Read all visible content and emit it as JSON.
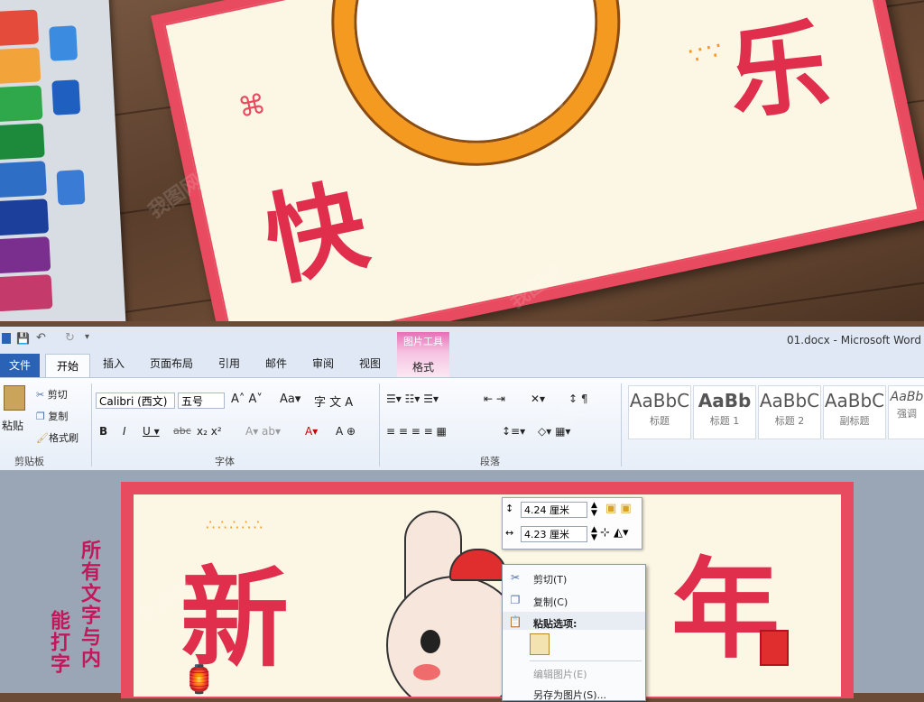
{
  "photo": {
    "chars": [
      "快",
      "乐"
    ]
  },
  "qat": {
    "title": "01.docx  -  Microsoft Word"
  },
  "tabs": {
    "file": "文件",
    "home": "开始",
    "items": [
      "插入",
      "页面布局",
      "引用",
      "邮件",
      "审阅",
      "视图"
    ],
    "picture_tools": "图片工具",
    "format": "格式"
  },
  "clipboard": {
    "paste": "粘贴",
    "cut": "剪切",
    "copy": "复制",
    "format_painter": "格式刷",
    "group": "剪贴板"
  },
  "font": {
    "name": "Calibri (西文)",
    "size": "五号",
    "group": "字体"
  },
  "paragraph": {
    "group": "段落"
  },
  "styles": {
    "items": [
      {
        "sample": "AaBbC",
        "name": "标题"
      },
      {
        "sample": "AaBb",
        "name": "标题 1"
      },
      {
        "sample": "AaBbC",
        "name": "标题 2"
      },
      {
        "sample": "AaBbC",
        "name": "副标题"
      },
      {
        "sample": "AaBb",
        "name": "强调"
      }
    ]
  },
  "document": {
    "chars": [
      "新",
      "年"
    ],
    "side_text_1": "所有文字与内",
    "side_text_2": "能打字"
  },
  "size_box": {
    "height": "4.24 厘米",
    "width": "4.23 厘米"
  },
  "context_menu": {
    "cut": "剪切(T)",
    "copy": "复制(C)",
    "paste_options": "粘贴选项:",
    "edit_picture": "编辑图片(E)",
    "save_as_picture": "另存为图片(S)..."
  },
  "colors": {
    "card_red": "#e84a5f",
    "card_cream": "#fcf6e4",
    "ring_orange": "#f59a21",
    "word_blue": "#2a62b5"
  }
}
